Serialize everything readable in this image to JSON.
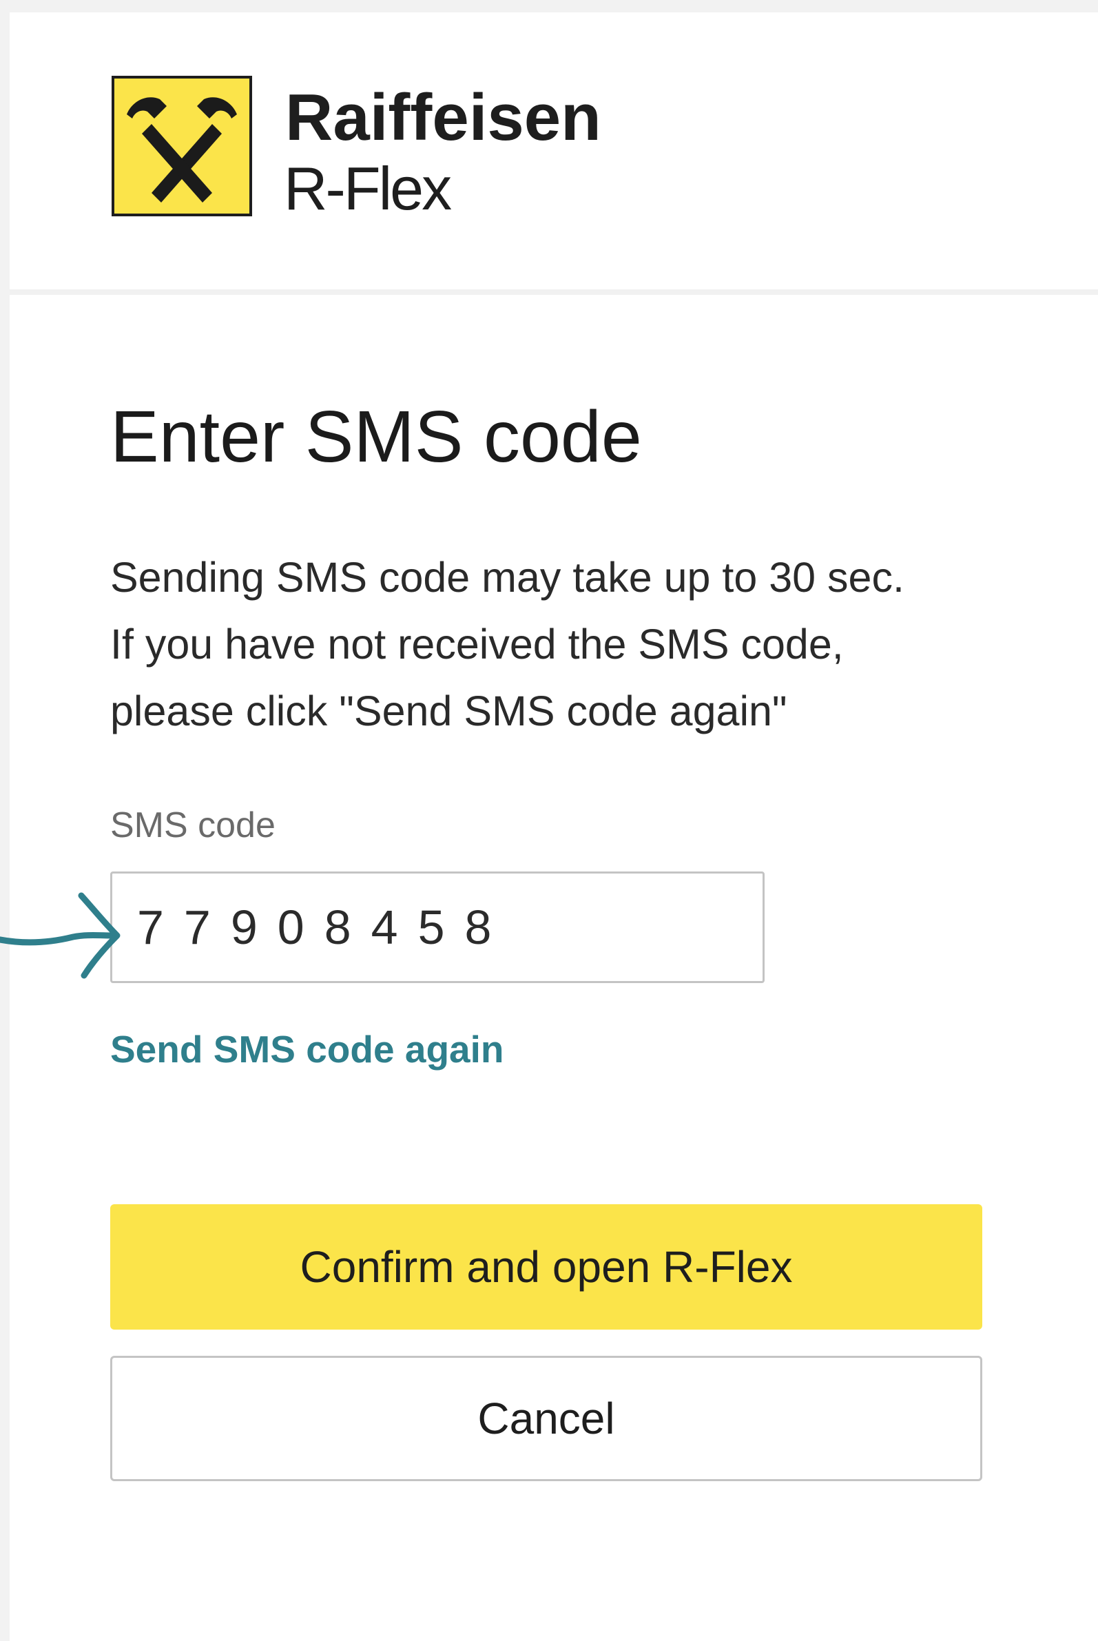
{
  "header": {
    "brand_name": "Raiffeisen",
    "product_name": "R-Flex",
    "logo_icon": "raiffeisen-crossed-horse-heads-logo",
    "logo_color": "#fbe44a"
  },
  "main": {
    "title": "Enter SMS code",
    "info_lines": [
      "Sending SMS code may take up to 30 sec.",
      "If you have not received the SMS code,",
      "please click \"Send SMS code again\""
    ],
    "sms_field": {
      "label": "SMS code",
      "value": "77908458"
    },
    "resend_link": "Send SMS code again",
    "annotation_icon": "pointer-arrow-icon",
    "accent_color": "#2f7f8c"
  },
  "actions": {
    "confirm_label": "Confirm and open R-Flex",
    "confirm_color": "#fbe44a",
    "cancel_label": "Cancel"
  }
}
